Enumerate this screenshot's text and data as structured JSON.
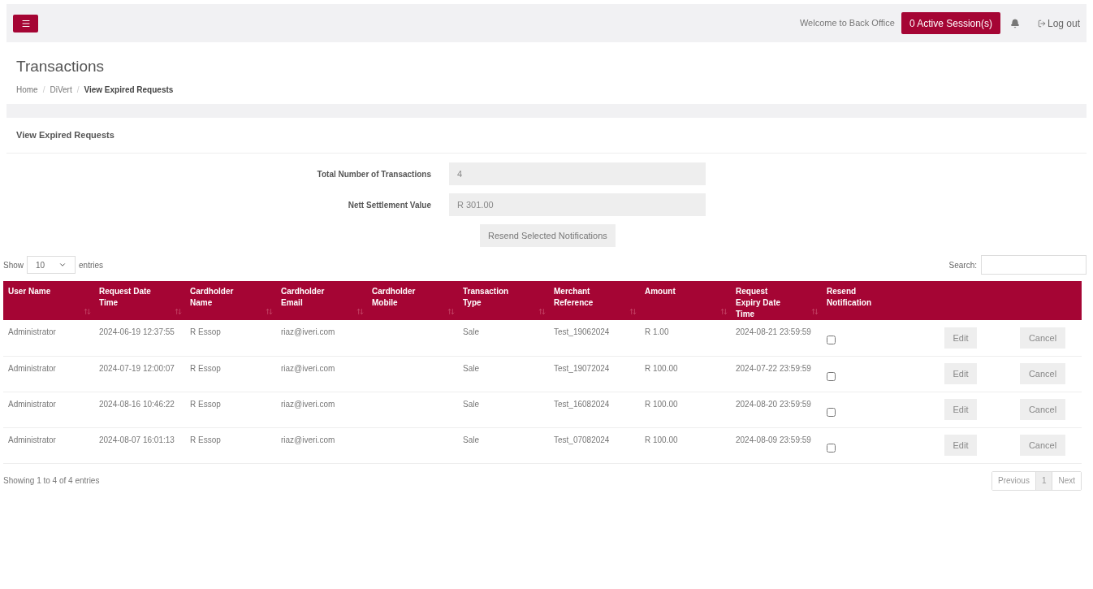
{
  "topbar": {
    "welcome": "Welcome to Back Office",
    "sessions_button": "0 Active Session(s)",
    "logout": "Log out"
  },
  "page": {
    "title": "Transactions",
    "separator": "/",
    "breadcrumb": [
      {
        "label": "Home",
        "current": false
      },
      {
        "label": "DiVert",
        "current": false
      },
      {
        "label": "View Expired Requests",
        "current": true
      }
    ]
  },
  "panel": {
    "title": "View Expired Requests",
    "summary": [
      {
        "label": "Total Number of Transactions",
        "value": "4"
      },
      {
        "label": "Nett Settlement Value",
        "value": "R 301.00"
      }
    ],
    "resend_button": "Resend Selected Notifications",
    "length": {
      "show": "Show",
      "value": "10",
      "entries": "entries"
    },
    "search_label": "Search:",
    "table": {
      "columns": [
        {
          "label": "User Name",
          "sortable": true
        },
        {
          "label": "Request Date Time",
          "sortable": true
        },
        {
          "label": "Cardholder Name",
          "sortable": true
        },
        {
          "label": "Cardholder Email",
          "sortable": true
        },
        {
          "label": "Cardholder Mobile",
          "sortable": true
        },
        {
          "label": "Transaction Type",
          "sortable": true
        },
        {
          "label": "Merchant Reference",
          "sortable": true
        },
        {
          "label": "Amount",
          "sortable": true
        },
        {
          "label": "Request Expiry Date Time",
          "sortable": true
        },
        {
          "label": "Resend Notification",
          "sortable": false
        }
      ],
      "rows": [
        {
          "user": "Administrator",
          "requested": "2024-06-19 12:37:55",
          "name": "R Essop",
          "email": "riaz@iveri.com",
          "type": "Sale",
          "reference": "Test_19062024",
          "amount": "R 1.00",
          "expiry": "2024-08-21 23:59:59",
          "checked": false,
          "edit": "Edit",
          "cancel": "Cancel"
        },
        {
          "user": "Administrator",
          "requested": "2024-07-19 12:00:07",
          "name": "R Essop",
          "email": "riaz@iveri.com",
          "type": "Sale",
          "reference": "Test_19072024",
          "amount": "R 100.00",
          "expiry": "2024-07-22 23:59:59",
          "checked": false,
          "edit": "Edit",
          "cancel": "Cancel"
        },
        {
          "user": "Administrator",
          "requested": "2024-08-16 10:46:22",
          "name": "R Essop",
          "email": "riaz@iveri.com",
          "type": "Sale",
          "reference": "Test_16082024",
          "amount": "R 100.00",
          "expiry": "2024-08-20 23:59:59",
          "checked": false,
          "edit": "Edit",
          "cancel": "Cancel"
        },
        {
          "user": "Administrator",
          "requested": "2024-08-07 16:01:13",
          "name": "R Essop",
          "email": "riaz@iveri.com",
          "type": "Sale",
          "reference": "Test_07082024",
          "amount": "R 100.00",
          "expiry": "2024-08-09 23:59:59",
          "checked": false,
          "edit": "Edit",
          "cancel": "Cancel"
        }
      ]
    },
    "info": "Showing 1 to 4 of 4 entries",
    "pagination": [
      {
        "label": "Previous",
        "selected": false
      },
      {
        "label": "1",
        "selected": true
      },
      {
        "label": "Next",
        "selected": false
      }
    ]
  }
}
